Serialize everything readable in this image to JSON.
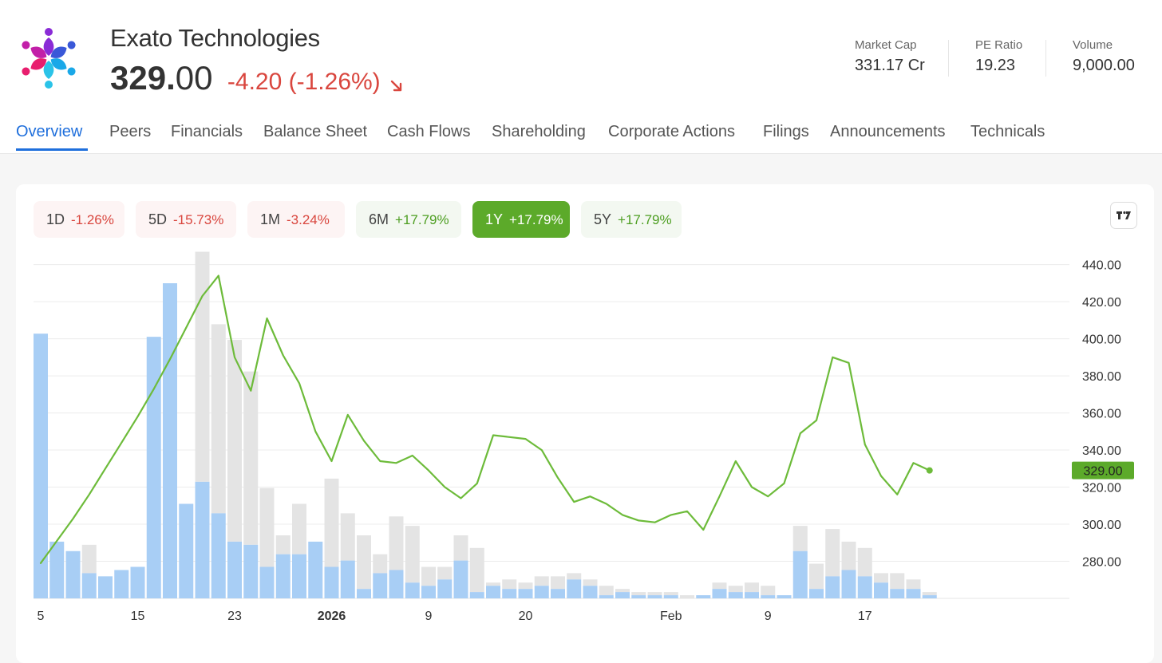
{
  "header": {
    "company_name": "Exato Technologies",
    "price_integer": "329.",
    "price_decimal": "00",
    "change": "-4.20 (-1.26%)"
  },
  "stats": [
    {
      "label": "Market Cap",
      "value": "331.17 Cr"
    },
    {
      "label": "PE Ratio",
      "value": "19.23"
    },
    {
      "label": "Volume",
      "value": "9,000.00"
    }
  ],
  "tabs": [
    "Overview",
    "Peers",
    "Financials",
    "Balance Sheet",
    "Cash Flows",
    "Shareholding",
    "Corporate Actions",
    "Filings",
    "Announcements",
    "Technicals"
  ],
  "active_tab": "Overview",
  "ranges": [
    {
      "label": "1D",
      "change": "-1.26%",
      "direction": "neg"
    },
    {
      "label": "5D",
      "change": "-15.73%",
      "direction": "neg"
    },
    {
      "label": "1M",
      "change": "-3.24%",
      "direction": "neg"
    },
    {
      "label": "6M",
      "change": "+17.79%",
      "direction": "pos"
    },
    {
      "label": "1Y",
      "change": "+17.79%",
      "direction": "pos",
      "active": true
    },
    {
      "label": "5Y",
      "change": "+17.79%",
      "direction": "pos"
    }
  ],
  "colors": {
    "accent": "#1f6fdc",
    "negative": "#d9463e",
    "positive": "#5caa2a",
    "price_line": "#6dbb3a",
    "volume_bar": "#a8cef5",
    "volume_bar_other": "#e4e4e4"
  },
  "icons": {
    "logo": "multicolor-people-star-logo",
    "change_direction": "arrow-down-right-icon",
    "chart_tool": "tradingview-icon"
  },
  "chart_data": {
    "type": "line",
    "y_axis_side": "right",
    "ylim": [
      260,
      445
    ],
    "y_ticks": [
      "440.00",
      "420.00",
      "400.00",
      "380.00",
      "360.00",
      "340.00",
      "320.00",
      "300.00",
      "280.00"
    ],
    "x_tick_labels": [
      {
        "label": "5",
        "index": 0,
        "bold": false
      },
      {
        "label": "15",
        "index": 6,
        "bold": false
      },
      {
        "label": "23",
        "index": 12,
        "bold": false
      },
      {
        "label": "2026",
        "index": 18,
        "bold": true
      },
      {
        "label": "9",
        "index": 24,
        "bold": false
      },
      {
        "label": "20",
        "index": 30,
        "bold": false
      },
      {
        "label": "Feb",
        "index": 39,
        "bold": false
      },
      {
        "label": "9",
        "index": 45,
        "bold": false
      },
      {
        "label": "17",
        "index": 51,
        "bold": false
      }
    ],
    "last_value_label": "329.00",
    "grid": true,
    "series": [
      {
        "type": "line",
        "values": [
          279,
          291,
          303,
          316,
          330,
          344,
          358,
          373,
          389,
          406,
          423,
          434,
          390,
          372,
          411,
          391,
          376,
          350,
          334,
          359,
          345,
          334,
          333,
          337,
          329,
          320,
          314,
          322,
          348,
          347,
          346,
          340,
          325,
          312,
          315,
          311,
          305,
          302,
          301,
          305,
          307,
          297,
          315,
          334,
          320,
          315,
          322,
          349,
          356,
          390,
          387,
          343,
          326,
          316,
          333,
          329
        ]
      },
      {
        "type": "volume",
        "values": [
          84,
          18,
          15,
          8,
          7,
          9,
          10,
          83,
          100,
          30,
          37,
          27,
          18,
          17,
          10,
          14,
          14,
          18,
          10,
          12,
          3,
          8,
          9,
          5,
          4,
          6,
          12,
          2,
          4,
          3,
          3,
          4,
          3,
          6,
          4,
          1,
          2,
          1,
          1,
          1,
          0,
          1,
          3,
          2,
          2,
          1,
          1,
          15,
          3,
          7,
          9,
          7,
          5,
          3,
          3,
          1
        ],
        "other_values": [
          0,
          0,
          0,
          9,
          0,
          0,
          0,
          0,
          0,
          0,
          73,
          60,
          64,
          55,
          25,
          6,
          16,
          0,
          28,
          15,
          17,
          6,
          17,
          18,
          6,
          4,
          8,
          14,
          1,
          3,
          2,
          3,
          4,
          2,
          2,
          3,
          1,
          1,
          1,
          1,
          1,
          0,
          2,
          2,
          3,
          3,
          0,
          8,
          8,
          15,
          9,
          9,
          3,
          5,
          3,
          1
        ]
      }
    ]
  }
}
